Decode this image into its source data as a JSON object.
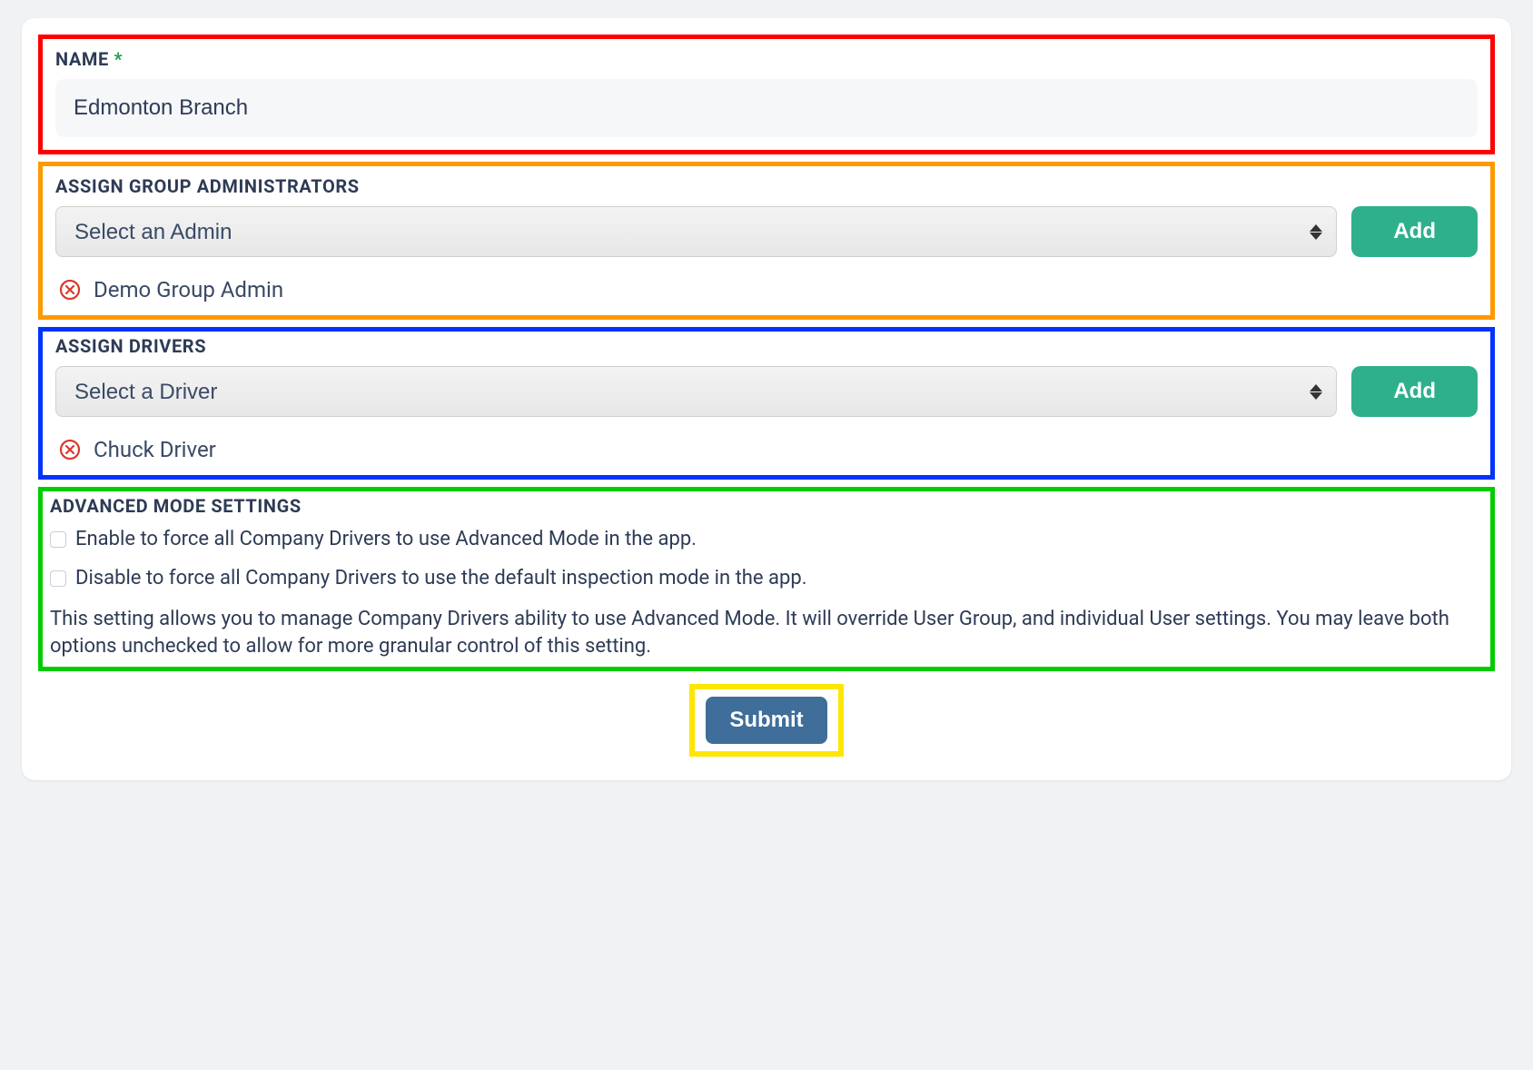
{
  "name_section": {
    "label": "NAME",
    "required_marker": "*",
    "value": "Edmonton Branch"
  },
  "admins_section": {
    "label": "ASSIGN GROUP ADMINISTRATORS",
    "select_placeholder": "Select an Admin",
    "add_button": "Add",
    "assigned": [
      {
        "name": "Demo Group Admin"
      }
    ]
  },
  "drivers_section": {
    "label": "ASSIGN DRIVERS",
    "select_placeholder": "Select a Driver",
    "add_button": "Add",
    "assigned": [
      {
        "name": "Chuck Driver"
      }
    ]
  },
  "advanced_section": {
    "label": "ADVANCED MODE SETTINGS",
    "enable_text": "Enable to force all Company Drivers to use Advanced Mode in the app.",
    "disable_text": "Disable to force all Company Drivers to use the default inspection mode in the app.",
    "enable_checked": false,
    "disable_checked": false,
    "description": "This setting allows you to manage Company Drivers ability to use Advanced Mode. It will override User Group, and individual User settings. You may leave both options unchecked to allow for more granular control of this setting."
  },
  "submit_button": "Submit"
}
